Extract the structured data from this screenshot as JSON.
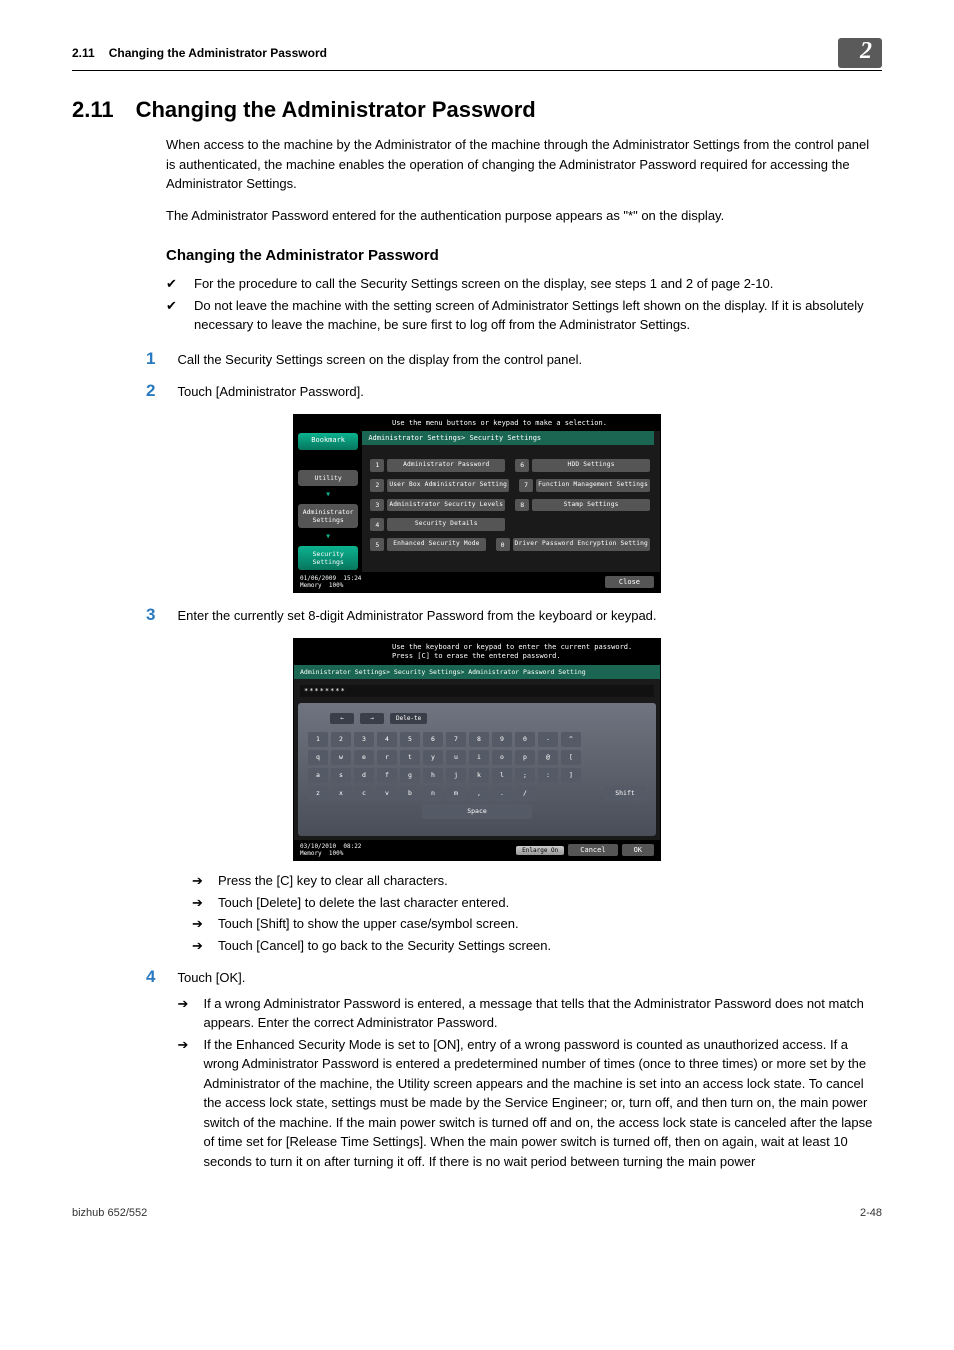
{
  "runhead": {
    "section": "2.11",
    "title": "Changing the Administrator Password",
    "chapter": "2"
  },
  "h1": {
    "num": "2.11",
    "title": "Changing the Administrator Password"
  },
  "intro": {
    "p1": "When access to the machine by the Administrator of the machine through the Administrator Settings from the control panel is authenticated, the machine enables the operation of changing the Administrator Password required for accessing the Administrator Settings.",
    "p2": "The Administrator Password entered for the authentication purpose appears as \"*\" on the display."
  },
  "h2": "Changing the Administrator Password",
  "checks": [
    "For the procedure to call the Security Settings screen on the display, see steps 1 and 2 of page 2-10.",
    "Do not leave the machine with the setting screen of Administrator Settings left shown on the display. If it is absolutely necessary to leave the machine, be sure first to log off from the Administrator Settings."
  ],
  "steps": {
    "s1": "Call the Security Settings screen on the display from the control panel.",
    "s2": "Touch [Administrator Password].",
    "s3": "Enter the currently set 8-digit Administrator Password from the keyboard or keypad.",
    "s4": "Touch [OK]."
  },
  "arrows3": [
    "Press the [C] key to clear all characters.",
    "Touch [Delete] to delete the last character entered.",
    "Touch [Shift] to show the upper case/symbol screen.",
    "Touch [Cancel] to go back to the Security Settings screen."
  ],
  "arrows4": [
    "If a wrong Administrator Password is entered, a message that tells that the Administrator Password does not match appears. Enter the correct Administrator Password.",
    "If the Enhanced Security Mode is set to [ON], entry of a wrong password is counted as unauthorized access. If a wrong Administrator Password is entered a predetermined number of times (once to three times) or more set by the Administrator of the machine, the Utility screen appears and the machine is set into an access lock state. To cancel the access lock state, settings must be made by the Service Engineer; or, turn off, and then turn on, the main power switch of the machine. If the main power switch is turned off and on, the access lock state is canceled after the lapse of time set for [Release Time Settings]. When the main power switch is turned off, then on again, wait at least 10 seconds to turn it on after turning it off. If there is no wait period between turning the main power"
  ],
  "footer": {
    "model": "bizhub 652/552",
    "page": "2-48"
  },
  "shot1": {
    "hdr": "Use the menu buttons or keypad to make a selection.",
    "bookmark": "Bookmark",
    "side": {
      "utility": "Utility",
      "admin": "Administrator Settings",
      "sec": "Security Settings"
    },
    "crumb": "Administrator Settings> Security Settings",
    "menu": {
      "n1": "1",
      "m1": "Administrator Password",
      "n2": "2",
      "m2": "User Box Administrator Setting",
      "n3": "3",
      "m3": "Administrator Security Levels",
      "n4": "4",
      "m4": "Security Details",
      "n5": "5",
      "m5": "Enhanced Security Mode",
      "n6": "6",
      "m6": "HDD Settings",
      "n7": "7",
      "m7": "Function Management Settings",
      "n8": "8",
      "m8": "Stamp Settings",
      "n0": "0",
      "m0": "Driver Password Encryption Setting"
    },
    "date": "01/06/2009",
    "time": "15:24",
    "mem": "Memory",
    "pct": "100%",
    "close": "Close"
  },
  "shot2": {
    "hdr1": "Use the keyboard or keypad to enter the current password.",
    "hdr2": "Press [C] to erase the entered password.",
    "crumb": "Administrator Settings> Security Settings> Administrator Password Setting",
    "masked": "********",
    "leftArr": "←",
    "rightArr": "→",
    "delete": "Dele-te",
    "rows": {
      "r1": [
        "1",
        "2",
        "3",
        "4",
        "5",
        "6",
        "7",
        "8",
        "9",
        "0",
        "-",
        "^"
      ],
      "r2": [
        "q",
        "w",
        "e",
        "r",
        "t",
        "y",
        "u",
        "i",
        "o",
        "p",
        "@",
        "["
      ],
      "r3": [
        "a",
        "s",
        "d",
        "f",
        "g",
        "h",
        "j",
        "k",
        "l",
        ";",
        ":",
        "]"
      ],
      "r4": [
        "z",
        "x",
        "c",
        "v",
        "b",
        "n",
        "m",
        ",",
        ".",
        "/"
      ]
    },
    "shift": "Shift",
    "space": "Space",
    "date": "03/10/2010",
    "time": "08:22",
    "mem": "Memory",
    "pct": "100%",
    "enlarge": "Enlarge On",
    "cancel": "Cancel",
    "ok": "OK"
  }
}
